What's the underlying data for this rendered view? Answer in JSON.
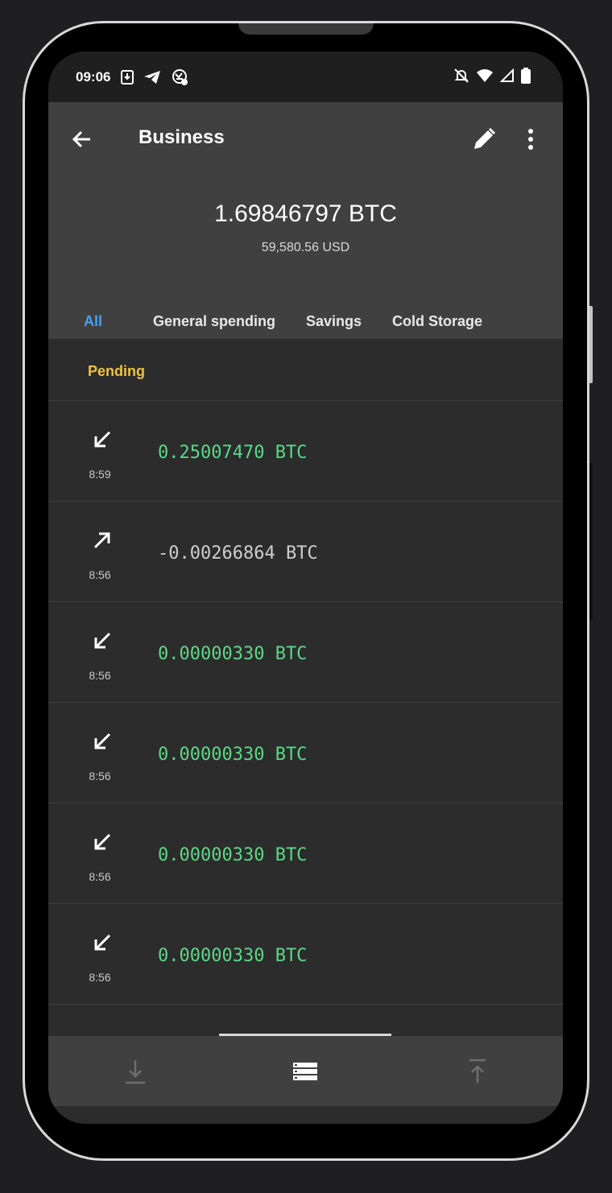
{
  "status_bar": {
    "time": "09:06",
    "left_icons": [
      "download-notification-icon",
      "telegram-icon",
      "app-notification-icon"
    ],
    "right_icons": [
      "bell-off-icon",
      "wifi-icon",
      "signal-icon",
      "battery-icon"
    ]
  },
  "app_bar": {
    "title": "Business"
  },
  "balance": {
    "btc": "1.69846797 BTC",
    "fiat": "59,580.56 USD"
  },
  "tabs": [
    {
      "label": "All",
      "active": true
    },
    {
      "label": "General spending",
      "active": false
    },
    {
      "label": "Savings",
      "active": false
    },
    {
      "label": "Cold Storage",
      "active": false
    }
  ],
  "pending": {
    "label": "Pending"
  },
  "transactions": [
    {
      "direction": "in",
      "time": "8:59",
      "amount": "0.25007470 BTC"
    },
    {
      "direction": "out",
      "time": "8:56",
      "amount": "-0.00266864 BTC"
    },
    {
      "direction": "in",
      "time": "8:56",
      "amount": "0.00000330 BTC"
    },
    {
      "direction": "in",
      "time": "8:56",
      "amount": "0.00000330 BTC"
    },
    {
      "direction": "in",
      "time": "8:56",
      "amount": "0.00000330 BTC"
    },
    {
      "direction": "in",
      "time": "8:56",
      "amount": "0.00000330 BTC"
    }
  ],
  "bottom_nav": {
    "items": [
      "receive-icon",
      "list-icon",
      "send-icon"
    ]
  },
  "colors": {
    "accent": "#4c9ff0",
    "pending": "#f0c244",
    "incoming": "#5cd889"
  }
}
